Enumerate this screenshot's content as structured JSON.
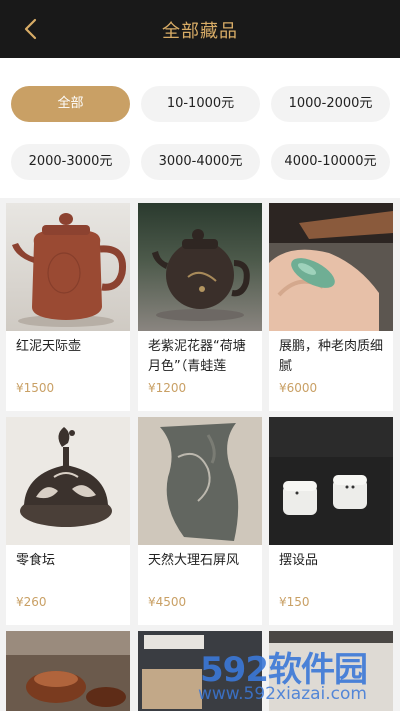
{
  "header": {
    "title": "全部藏品",
    "back_icon": "chevron-left-icon"
  },
  "filters": [
    {
      "label": "全部",
      "active": true
    },
    {
      "label": "10-1000元",
      "active": false
    },
    {
      "label": "1000-2000元",
      "active": false
    },
    {
      "label": "2000-3000元",
      "active": false
    },
    {
      "label": "3000-4000元",
      "active": false
    },
    {
      "label": "4000-10000元",
      "active": false
    }
  ],
  "items": [
    {
      "title": "红泥天际壶",
      "price": "¥1500"
    },
    {
      "title": "老紫泥花器“荷塘月色”（青蛙莲",
      "price": "¥1200"
    },
    {
      "title": "展鹏，种老肉质细腻",
      "price": "¥6000"
    },
    {
      "title": "零食坛",
      "price": "¥260"
    },
    {
      "title": "天然大理石屏风",
      "price": "¥4500"
    },
    {
      "title": "摆设品",
      "price": "¥150"
    }
  ],
  "watermark": {
    "logo": "592软件园",
    "url": "www.592xiazai.com"
  },
  "colors": {
    "accent": "#c9a065",
    "header_bg": "#191919",
    "title": "#d8ac66"
  }
}
